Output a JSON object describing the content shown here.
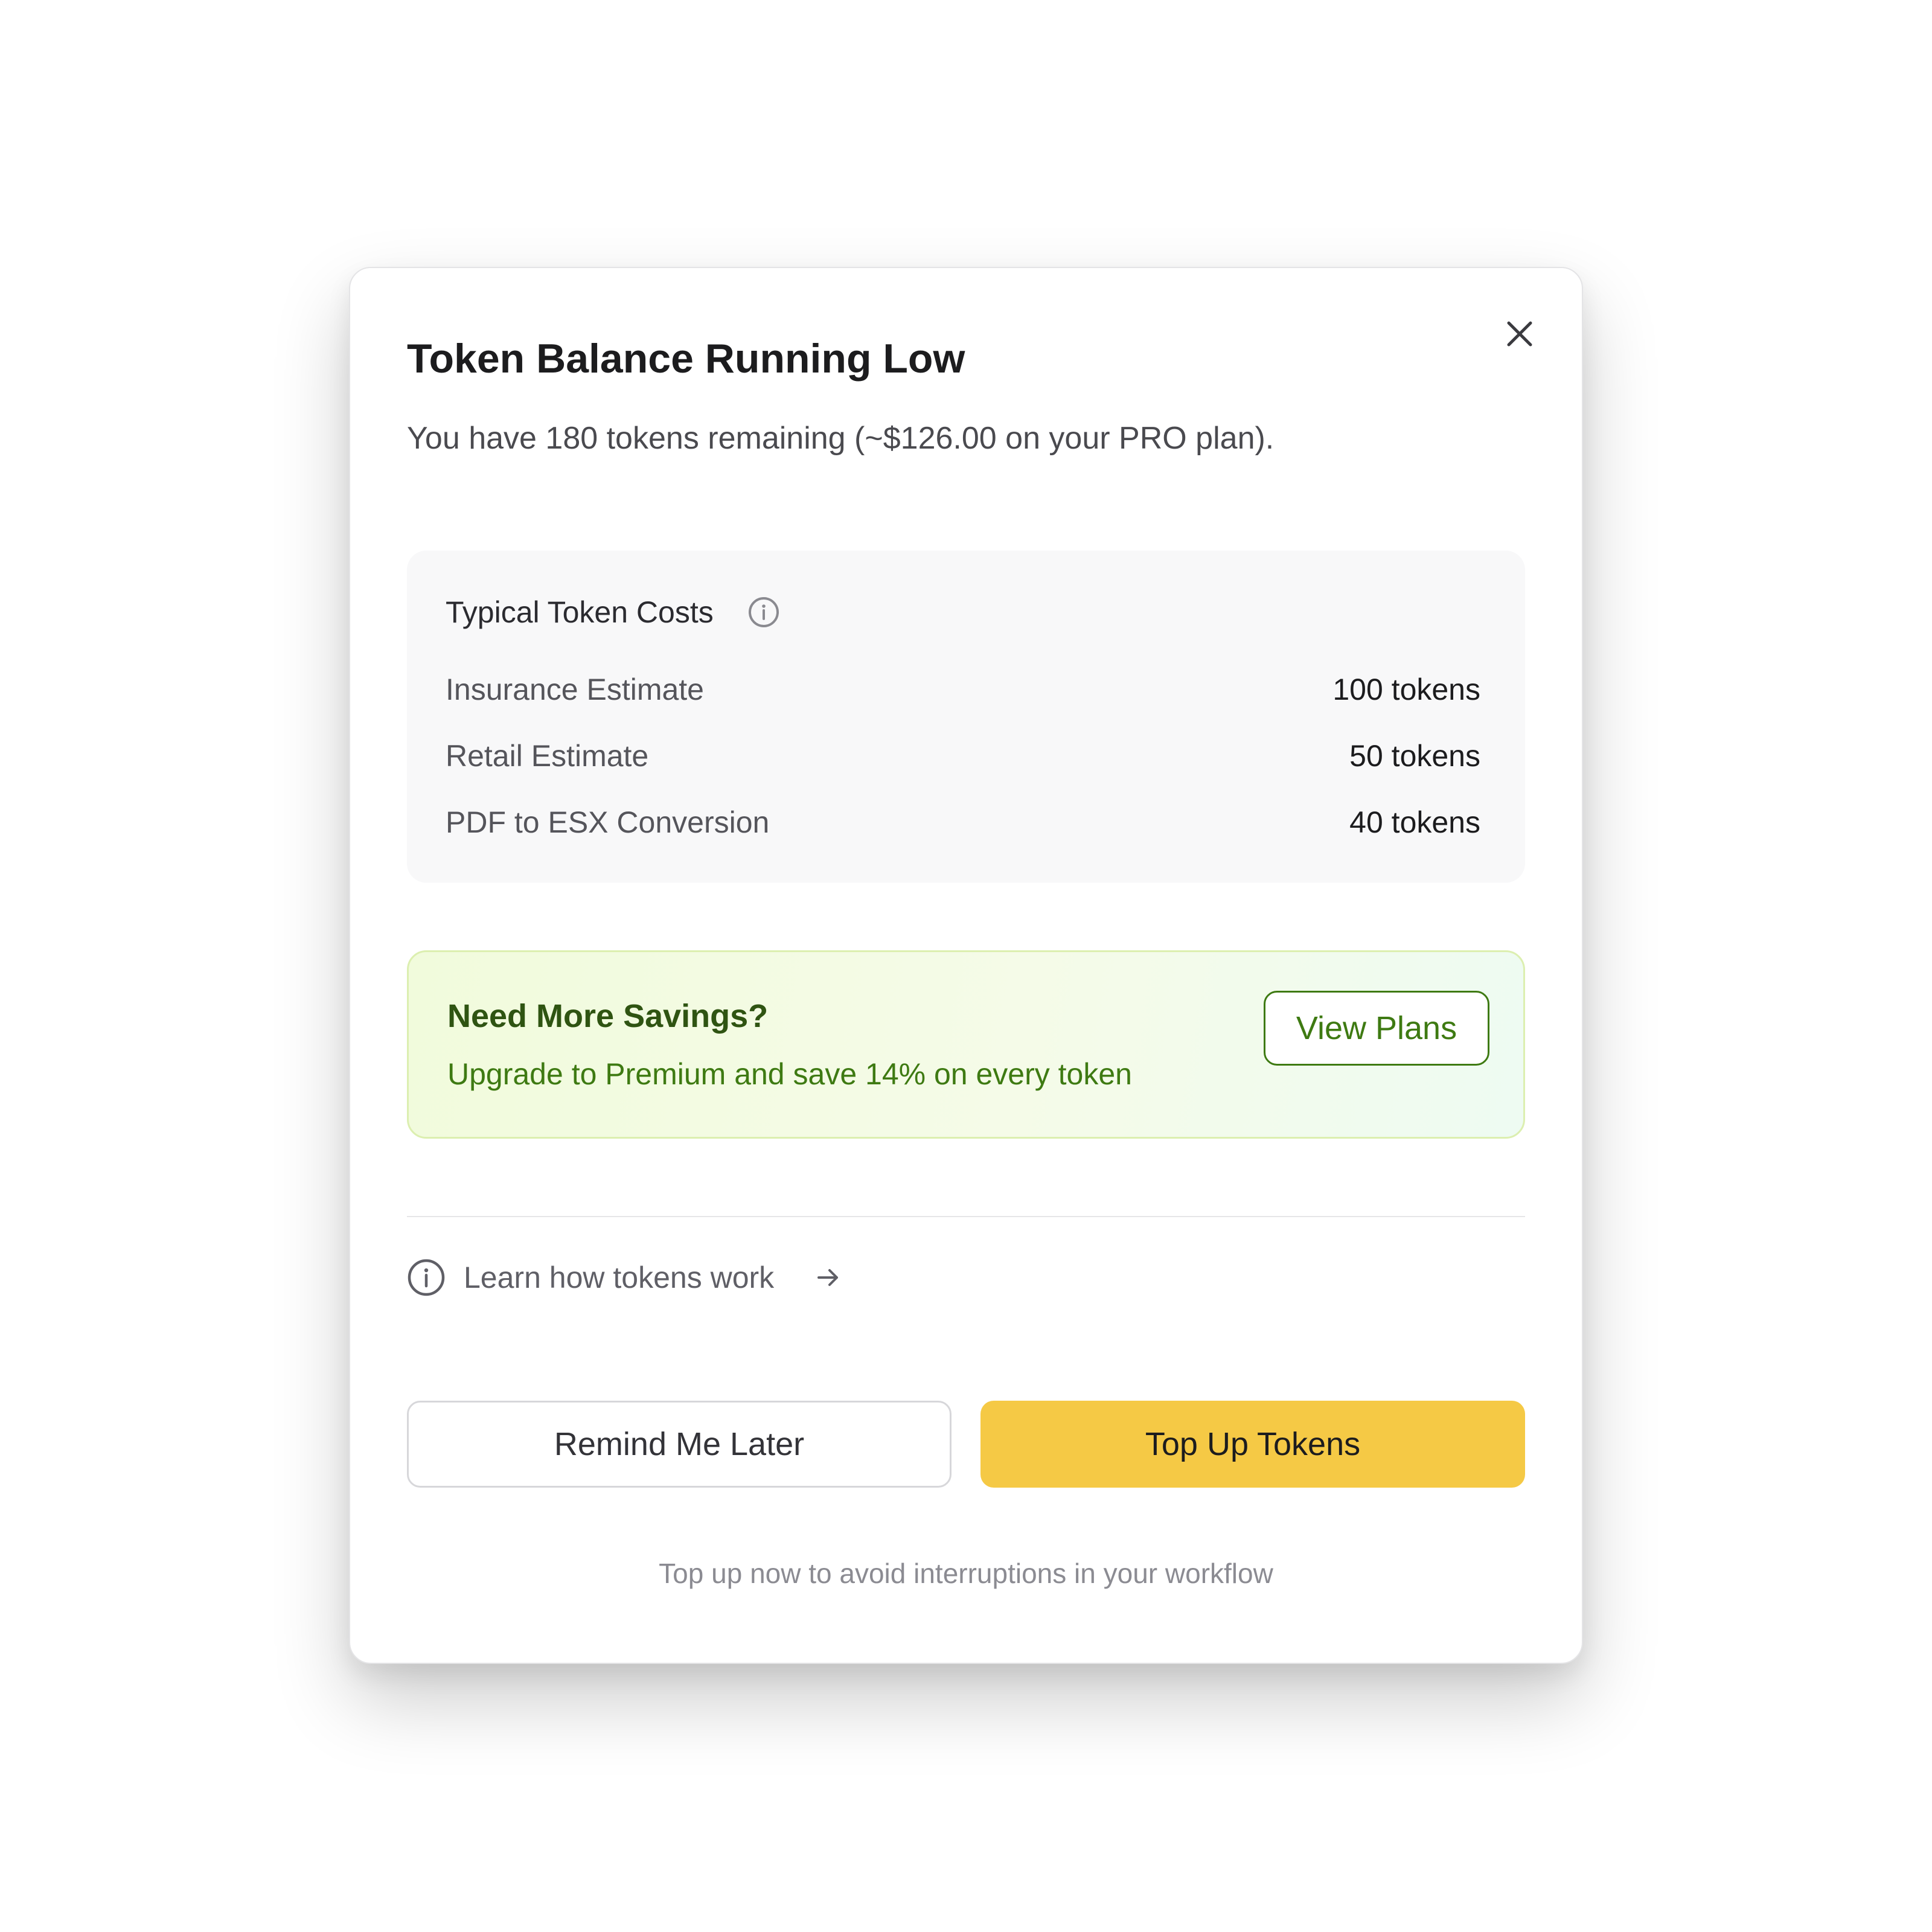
{
  "modal": {
    "title": "Token Balance Running Low",
    "subtitle": "You have 180 tokens remaining (~$126.00 on your PRO plan).",
    "close_icon": "close-icon"
  },
  "costs": {
    "title": "Typical Token Costs",
    "info_icon": "info-icon",
    "items": [
      {
        "label": "Insurance Estimate",
        "value": "100 tokens"
      },
      {
        "label": "Retail Estimate",
        "value": "50 tokens"
      },
      {
        "label": "PDF to ESX Conversion",
        "value": "40 tokens"
      }
    ]
  },
  "promo": {
    "title": "Need More Savings?",
    "text": "Upgrade to Premium and save 14% on every token",
    "button_label": "View Plans",
    "accent_color": "#3e7a12"
  },
  "learn": {
    "label": "Learn how tokens work",
    "icon": "info-icon",
    "arrow_icon": "arrow-right-icon"
  },
  "actions": {
    "secondary_label": "Remind Me Later",
    "primary_label": "Top Up Tokens",
    "primary_color": "#f5c945"
  },
  "footer_note": "Top up now to avoid interruptions in your workflow"
}
